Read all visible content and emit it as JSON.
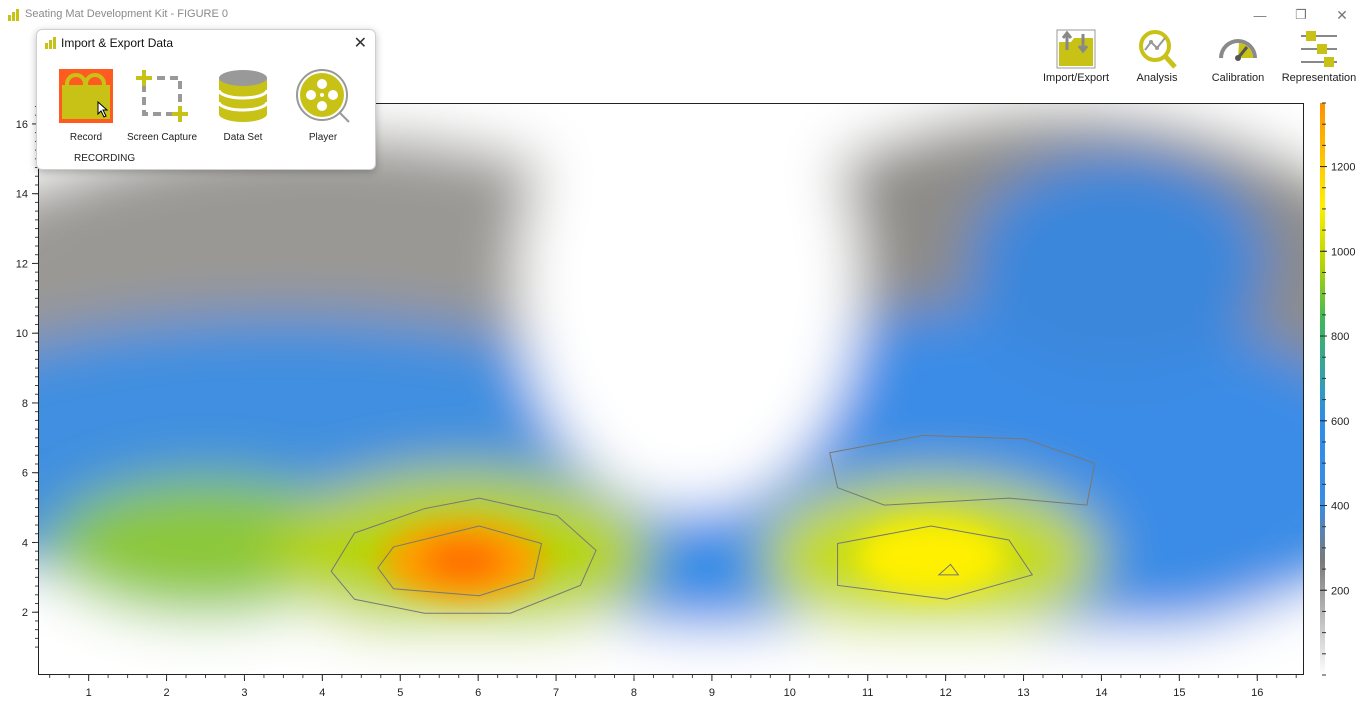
{
  "window": {
    "title": "Seating Mat Development Kit - FIGURE 0",
    "min_glyph": "—",
    "max_glyph": "❐",
    "close_glyph": "✕"
  },
  "toolbar": {
    "items": [
      {
        "label": "Import/Export",
        "icon": "import-export-icon"
      },
      {
        "label": "Analysis",
        "icon": "analysis-icon"
      },
      {
        "label": "Calibration",
        "icon": "calibration-gauge-icon"
      },
      {
        "label": "Representation",
        "icon": "representation-sliders-icon"
      }
    ]
  },
  "popup": {
    "title": "Import & Export Data",
    "close_glyph": "✕",
    "items": [
      {
        "label": "Record",
        "icon": "record-icon"
      },
      {
        "label": "Screen Capture",
        "icon": "screen-capture-icon"
      },
      {
        "label": "Data Set",
        "icon": "database-icon"
      },
      {
        "label": "Player",
        "icon": "film-reel-icon"
      }
    ],
    "status": "RECORDING"
  },
  "colors": {
    "accent": "#c8c217",
    "record_bg": "#ff5a1f",
    "plot_blue": "#2e8ee6",
    "hot": "#ff7a00"
  },
  "chart_data": {
    "type": "heatmap",
    "x_ticks": [
      "1",
      "2",
      "3",
      "4",
      "5",
      "6",
      "7",
      "8",
      "9",
      "10",
      "11",
      "12",
      "13",
      "14",
      "15",
      "16"
    ],
    "y_ticks": [
      "2",
      "4",
      "6",
      "8",
      "10",
      "12",
      "14",
      "16"
    ],
    "xlim": [
      0.35,
      16.6
    ],
    "ylim": [
      0.2,
      16.6
    ],
    "colorbar": {
      "ticks": [
        "200",
        "400",
        "600",
        "800",
        "1000",
        "1200"
      ],
      "range": [
        0,
        1350
      ]
    },
    "hotspots": [
      {
        "x": 5.8,
        "y": 3.5,
        "value": 1250
      },
      {
        "x": 11.8,
        "y": 3.6,
        "value": 1100
      }
    ]
  }
}
